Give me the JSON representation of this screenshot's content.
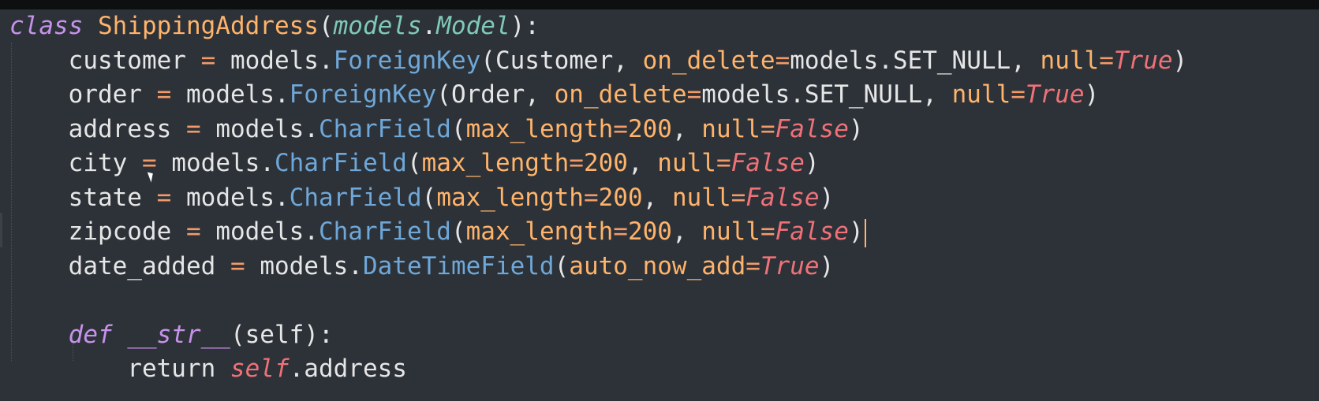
{
  "editor": {
    "language": "python",
    "colors": {
      "background": "#2c3238",
      "keyword": "#c792ea",
      "class_name": "#ffb36b",
      "field_type": "#6fa7d8",
      "boolean": "#f07178",
      "argument": "#ffb36b",
      "caret": "#ffb36b"
    },
    "lines": {
      "l1": {
        "kw_class": "class",
        "class_name": "ShippingAddress",
        "paren_open": "(",
        "base_module": "models",
        "dot": ".",
        "base_class": "Model",
        "tail": "):"
      },
      "l2": {
        "name": "customer",
        "eq": "=",
        "models": "models",
        "field": "ForeignKey",
        "ref": "Customer",
        "arg1": "on_delete",
        "arg1_val": "models.SET_NULL",
        "arg2": "null",
        "arg2_val": "True"
      },
      "l3": {
        "name": "order",
        "eq": "=",
        "models": "models",
        "field": "ForeignKey",
        "ref": "Order",
        "arg1": "on_delete",
        "arg1_val": "models.SET_NULL",
        "arg2": "null",
        "arg2_val": "True"
      },
      "l4": {
        "name": "address",
        "eq": "=",
        "models": "models",
        "field": "CharField",
        "arg1": "max_length",
        "arg1_val": "200",
        "arg2": "null",
        "arg2_val": "False"
      },
      "l5": {
        "name": "city",
        "eq": "=",
        "models": "models",
        "field": "CharField",
        "arg1": "max_length",
        "arg1_val": "200",
        "arg2": "null",
        "arg2_val": "False"
      },
      "l6": {
        "name": "state",
        "eq": "=",
        "models": "models",
        "field": "CharField",
        "arg1": "max_length",
        "arg1_val": "200",
        "arg2": "null",
        "arg2_val": "False"
      },
      "l7": {
        "name": "zipcode",
        "eq": "=",
        "models": "models",
        "field": "CharField",
        "arg1": "max_length",
        "arg1_val": "200",
        "arg2": "null",
        "arg2_val": "False"
      },
      "l8": {
        "name": "date_added",
        "eq": "=",
        "models": "models",
        "field": "DateTimeField",
        "arg1": "auto_now_add",
        "arg1_val": "True"
      },
      "l10": {
        "kw_def": "def",
        "func": "__str__",
        "params": "(self):"
      },
      "l11": {
        "kw_return": "return",
        "self_kw": "self",
        "attr": ".address"
      }
    }
  }
}
